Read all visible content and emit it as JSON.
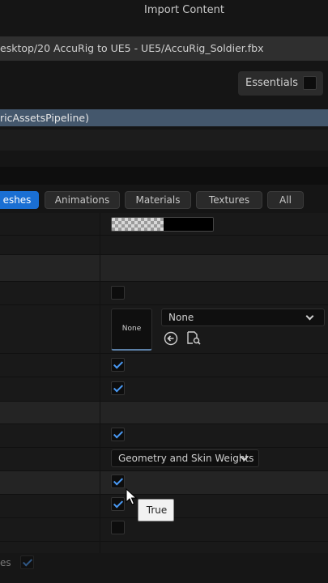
{
  "window": {
    "title": "Import Content"
  },
  "path": {
    "text": "esktop/20 AccuRig to UE5 - UE5/AccuRig_Soldier.fbx"
  },
  "essentials": {
    "label": "Essentials",
    "checked": false
  },
  "pipeline": {
    "text": "ricAssetsPipeline)"
  },
  "tabs": [
    {
      "label": "eshes",
      "active": true
    },
    {
      "label": "Animations",
      "active": false
    },
    {
      "label": "Materials",
      "active": false
    },
    {
      "label": "Textures",
      "active": false
    },
    {
      "label": "All",
      "active": false
    }
  ],
  "material": {
    "thumbnail_label": "None",
    "dropdown_value": "None",
    "icons": [
      "use-selected-arrow-icon",
      "browse-asset-icon"
    ]
  },
  "skin": {
    "dropdown_value": "Geometry and Skin Weights"
  },
  "checkboxes": {
    "row1": false,
    "row2": true,
    "row3": true,
    "row4": true,
    "row5": true,
    "row6": true,
    "row7": false,
    "bottom": true
  },
  "tooltip": {
    "text": "True"
  },
  "bottom": {
    "label": "es"
  },
  "colors": {
    "accent": "#1a6fd3",
    "selection": "#44576c",
    "check": "#4a9af5"
  }
}
